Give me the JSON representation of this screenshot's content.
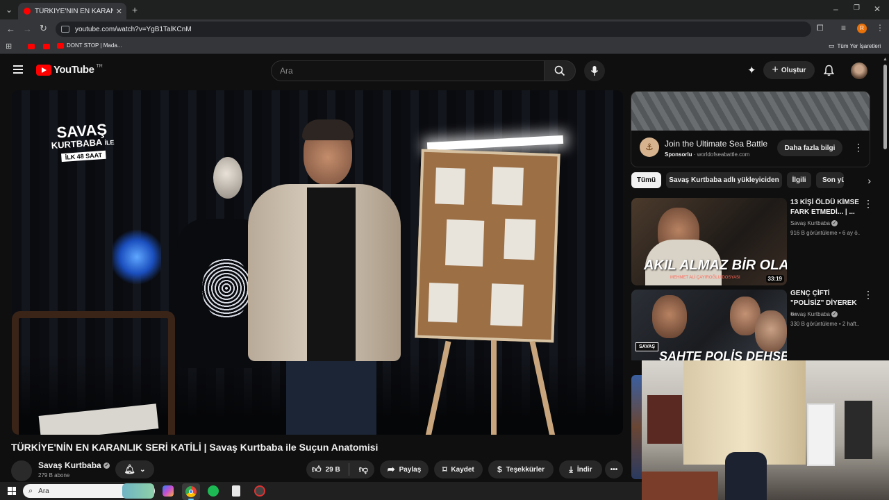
{
  "browser": {
    "tab_title": "TÜRKİYE'NİN EN KARANLIK SERİ KATİLİ | Savaş Kurtbaba ile Suçun Anatomisi",
    "url": "youtube.com/watch?v=YgB1TalKCnM",
    "profile_initial": "R",
    "bookmark_label": "DONT STOP | Mada...",
    "all_bookmarks": "Tüm Yer İşaretleri"
  },
  "youtube": {
    "logo_text": "YouTube",
    "region": "TR",
    "search_placeholder": "Ara",
    "create_label": "Oluştur"
  },
  "video": {
    "title": "TÜRKİYE'NİN EN KARANLIK SERİ KATİLİ | Savaş Kurtbaba ile Suçun Anatomisi",
    "show_logo_line1": "SAVAŞ",
    "show_logo_line2": "KURTBABA",
    "show_logo_line3": "İLE",
    "show_logo_line4": "İLK 48 SAAT",
    "channel_name": "Savaş Kurtbaba",
    "subscribers": "279 B abone",
    "likes": "29 B",
    "share_label": "Paylaş",
    "save_label": "Kaydet",
    "thanks_label": "Teşekkürler",
    "download_label": "İndir"
  },
  "ad": {
    "title": "Join the Ultimate Sea Battle",
    "sponsored": "Sponsorlu",
    "domain": "worldofseabattle.com",
    "cta": "Daha fazla bilgi"
  },
  "chips": [
    "Tümü",
    "Savaş Kurtbaba adlı yükleyiciden",
    "İlgili",
    "Son yü"
  ],
  "recommendations": [
    {
      "title_line1": "13 KİŞİ ÖLDÜ KİMSE",
      "title_line2": "FARK ETMEDİ... | ...",
      "channel": "Savaş Kurtbaba",
      "meta": "916 B görüntüleme • 6 ay ö...",
      "thumb_headline": "AKIL ALMAZ BİR OLAY",
      "thumb_sub": "MEHMET ALİ ÇAYIROĞLU DOSYASI",
      "duration": "33:19"
    },
    {
      "title_line1": "GENÇ ÇİFTİ",
      "title_line2": "\"POLİSİZ\" DİYEREK ...",
      "channel": "Savaş Kurtbaba",
      "meta": "330 B görüntüleme • 2 haft...",
      "thumb_headline": "SAHTE POLİS DEHŞETİ",
      "thumb_badge": "SAVAŞ"
    }
  ],
  "taskbar": {
    "search_placeholder": "Ara"
  },
  "colors": {
    "youtube_red": "#ff0000",
    "background": "#0f0f0f",
    "pill": "#272727"
  }
}
